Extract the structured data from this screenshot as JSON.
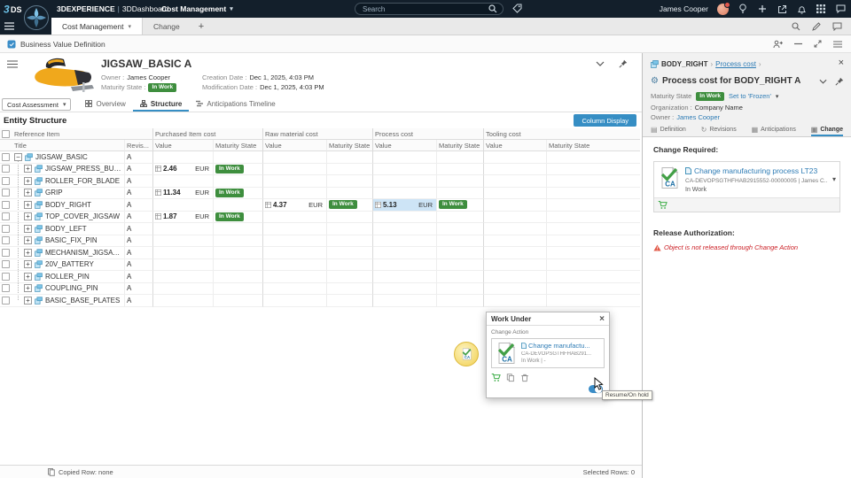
{
  "icons": {
    "dropdown_chevron": "▾",
    "breadcrumb_separator": "›",
    "close": "×",
    "gear": "⚙",
    "tab_definition_glyph": "▤",
    "tab_revisions_glyph": "↻",
    "tab_anticipations_glyph": "▦",
    "tab_change_glyph": "▣"
  },
  "top_bar": {
    "brand_primary": "3DEXPERIENCE",
    "brand_separator": "|",
    "brand_secondary": "3DDashboard",
    "app_menu_label": "Cost Management",
    "search_placeholder": "Search",
    "user_name": "James Cooper"
  },
  "tab_bar": {
    "active_tab": "Cost Management",
    "second_tab": "Change",
    "add_tab_label": "+"
  },
  "app_header": {
    "title": "Business Value Definition"
  },
  "content_header": {
    "title": "JIGSAW_BASIC A",
    "owner_label": "Owner :",
    "owner_value": "James Cooper",
    "maturity_label": "Maturity State :",
    "maturity_value": "In Work",
    "creation_label": "Creation Date :",
    "creation_value": "Dec 1, 2025, 4:03 PM",
    "modification_label": "Modification Date :",
    "modification_value": "Dec 1, 2025, 4:03 PM"
  },
  "view_bar": {
    "dropdown_label": "Cost Assessment",
    "tabs": [
      "Overview",
      "Structure",
      "Anticipations Timeline"
    ],
    "active_tab": "Structure"
  },
  "entity_section": {
    "title": "Entity Structure",
    "column_display_button": "Column Display"
  },
  "table": {
    "group_headers": [
      "Reference Item",
      "Purchased Item cost",
      "Raw material cost",
      "Process cost",
      "Tooling cost"
    ],
    "sub_headers": {
      "title": "Title",
      "revision": "Revis...",
      "value": "Value",
      "maturity": "Maturity State"
    },
    "currency": "EUR",
    "rows": [
      {
        "title": "JIGSAW_BASIC",
        "revision": "A",
        "level": 0,
        "expander": "minus",
        "costs": [
          null,
          null,
          null,
          null
        ]
      },
      {
        "title": "JIGSAW_PRESS_BUTTON",
        "revision": "A",
        "level": 1,
        "expander": "plus",
        "costs": [
          {
            "value": "2.46",
            "state": "In Work"
          },
          null,
          null,
          null
        ]
      },
      {
        "title": "ROLLER_FOR_BLADE",
        "revision": "A",
        "level": 1,
        "expander": "plus",
        "costs": [
          null,
          null,
          null,
          null
        ]
      },
      {
        "title": "GRIP",
        "revision": "A",
        "level": 1,
        "expander": "plus",
        "costs": [
          {
            "value": "11.34",
            "state": "In Work"
          },
          null,
          null,
          null
        ]
      },
      {
        "title": "BODY_RIGHT",
        "revision": "A",
        "level": 1,
        "expander": "plus",
        "costs": [
          null,
          {
            "value": "4.37",
            "state": "In Work"
          },
          {
            "value": "5.13",
            "state": "In Work",
            "selected": true
          },
          null
        ]
      },
      {
        "title": "TOP_COVER_JIGSAW",
        "revision": "A",
        "level": 1,
        "expander": "plus",
        "costs": [
          {
            "value": "1.87",
            "state": "In Work"
          },
          null,
          null,
          null
        ]
      },
      {
        "title": "BODY_LEFT",
        "revision": "A",
        "level": 1,
        "expander": "plus",
        "costs": [
          null,
          null,
          null,
          null
        ]
      },
      {
        "title": "BASIC_FIX_PIN",
        "revision": "A",
        "level": 1,
        "expander": "plus",
        "costs": [
          null,
          null,
          null,
          null
        ]
      },
      {
        "title": "MECHANISM_JIGSAW_CO...",
        "revision": "A",
        "level": 1,
        "expander": "plus",
        "costs": [
          null,
          null,
          null,
          null
        ]
      },
      {
        "title": "20V_BATTERY",
        "revision": "A",
        "level": 1,
        "expander": "plus",
        "costs": [
          null,
          null,
          null,
          null
        ]
      },
      {
        "title": "ROLLER_PIN",
        "revision": "A",
        "level": 1,
        "expander": "plus",
        "costs": [
          null,
          null,
          null,
          null
        ]
      },
      {
        "title": "COUPLING_PIN",
        "revision": "A",
        "level": 1,
        "expander": "plus",
        "costs": [
          null,
          null,
          null,
          null
        ]
      },
      {
        "title": "BASIC_BASE_PLATES",
        "revision": "A",
        "level": 1,
        "expander": "plus",
        "costs": [
          null,
          null,
          null,
          null
        ]
      }
    ]
  },
  "status_bar": {
    "copied_row": "Copied Row: none",
    "selected_rows": "Selected Rows: 0"
  },
  "right_panel": {
    "breadcrumb": [
      "BODY_RIGHT",
      "Process cost"
    ],
    "title": "Process cost for BODY_RIGHT A",
    "maturity_label": "Maturity State",
    "maturity_value": "In Work",
    "frozen_link": "Set to 'Frozen'",
    "organization_label": "Organization :",
    "organization_value": "Company Name",
    "owner_label": "Owner :",
    "owner_value": "James Cooper",
    "tabs": [
      "Definition",
      "Revisions",
      "Anticipations",
      "Change"
    ],
    "active_tab": "Change",
    "change_required_label": "Change Required:",
    "change_card": {
      "link": "Change manufacturing process LT23",
      "id_line": "CA-DEVOPSGTHFHAB2915552-00000005 | James C...",
      "state": "In Work"
    },
    "release_label": "Release Authorization:",
    "release_warning": "Object is not released through Change Action"
  },
  "work_under": {
    "title": "Work Under",
    "section_label": "Change Action",
    "item_link": "Change manufactu...",
    "item_id": "CA-DEVOPSGTHFHAB291...",
    "item_state": "In Work | -",
    "tooltip": "Resume/On hold"
  },
  "colors": {
    "accent_blue": "#368ec4",
    "state_green": "#3e8e3e",
    "warning_red": "#cb2026",
    "selection_blue": "#cde4f6"
  }
}
